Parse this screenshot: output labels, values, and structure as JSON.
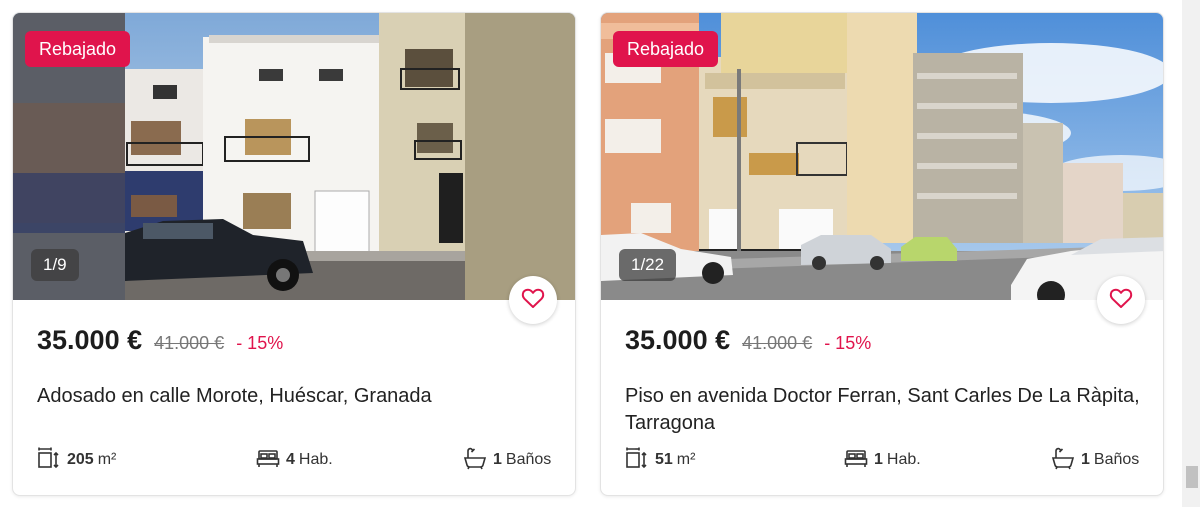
{
  "listings": [
    {
      "badge": "Rebajado",
      "photo_counter": "1/9",
      "price": "35.000 €",
      "old_price": "41.000 €",
      "discount": "- 15%",
      "title": "Adosado en calle Morote, Huéscar, Granada",
      "area_value": "205",
      "area_unit": "m²",
      "rooms_value": "4",
      "rooms_unit": "Hab.",
      "baths_value": "1",
      "baths_unit": "Baños"
    },
    {
      "badge": "Rebajado",
      "photo_counter": "1/22",
      "price": "35.000 €",
      "old_price": "41.000 €",
      "discount": "- 15%",
      "title": "Piso en avenida Doctor Ferran, Sant Carles De La Ràpita, Tarragona",
      "area_value": "51",
      "area_unit": "m²",
      "rooms_value": "1",
      "rooms_unit": "Hab.",
      "baths_value": "1",
      "baths_unit": "Baños"
    }
  ],
  "colors": {
    "accent": "#e0144c",
    "price_text": "#1d1d1d",
    "old_price_text": "#777777"
  },
  "icons": {
    "favorite": "heart-outline-icon",
    "area": "area-measure-icon",
    "rooms": "bed-icon",
    "baths": "bathtub-icon"
  }
}
